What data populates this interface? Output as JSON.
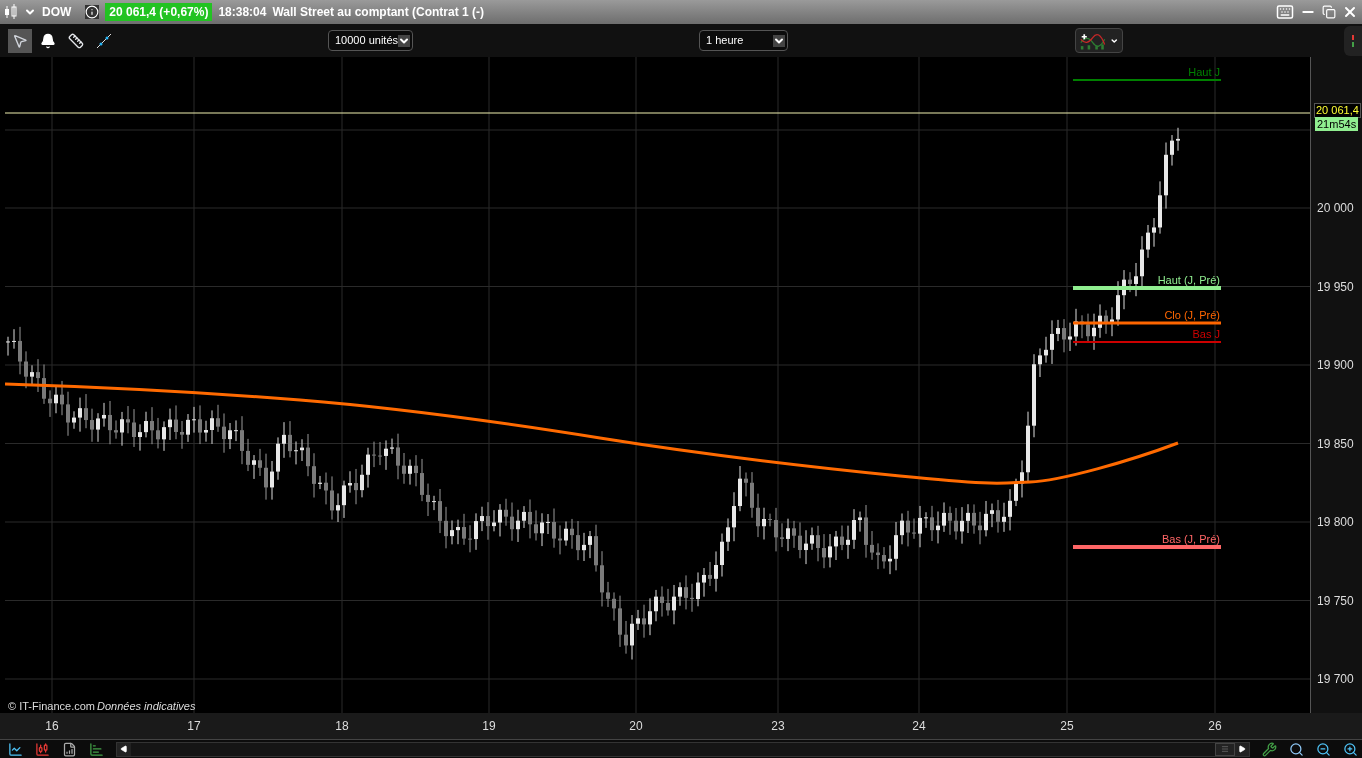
{
  "header": {
    "symbol": "DOW",
    "price_badge": "20 061,4 (+0,67%)",
    "time": "18:38:04",
    "title": "Wall Street au comptant (Contrat 1 (-)"
  },
  "toolbar": {
    "tools": [
      {
        "kind": "pointer",
        "selected": true
      },
      {
        "kind": "alert",
        "selected": false
      },
      {
        "kind": "ruler",
        "selected": false
      },
      {
        "kind": "line",
        "selected": false
      }
    ],
    "quantity": "10000 unités",
    "timeframe": "1 heure"
  },
  "chart": {
    "levels": [
      {
        "label": "Haut J",
        "color": "#008000"
      },
      {
        "label": "Haut (J, Pré)",
        "color": "#90ee90"
      },
      {
        "label": "Clo (J, Pré)",
        "color": "#ff6600"
      },
      {
        "label": "Bas J",
        "color": "#cc0000"
      },
      {
        "label": "Bas (J, Pré)",
        "color": "#ff6666"
      }
    ],
    "credit": "© IT-Finance.com",
    "note": "Données indicatives",
    "current_price": "20 061,4",
    "countdown": "21m54s",
    "y_ticks": [
      "20 000",
      "19 950",
      "19 900",
      "19 850",
      "19 800",
      "19 750",
      "19 700"
    ],
    "x_ticks": [
      "16",
      "17",
      "18",
      "19",
      "20",
      "23",
      "24",
      "25",
      "26"
    ]
  }
}
